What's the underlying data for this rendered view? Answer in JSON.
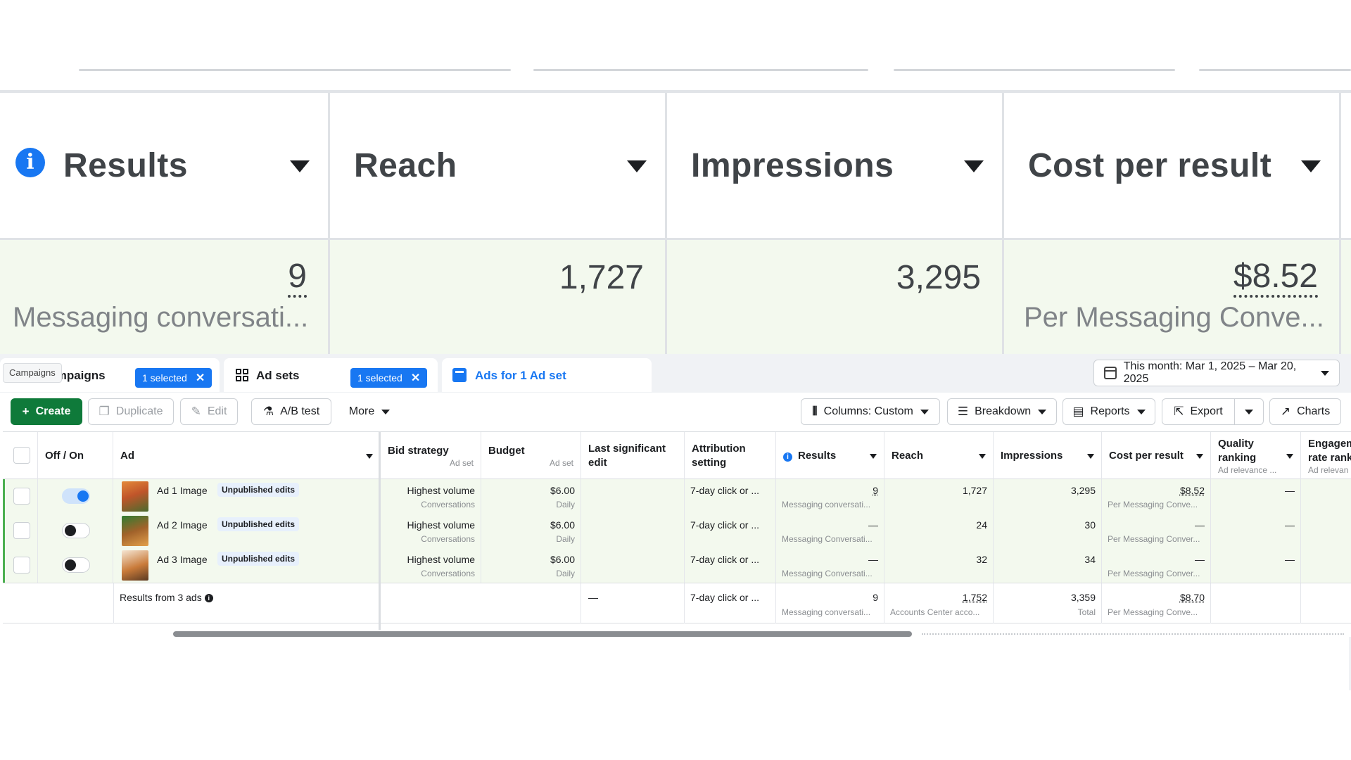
{
  "zoom": {
    "columns": [
      {
        "title": "Results",
        "value": "9",
        "sub": "Messaging conversati..."
      },
      {
        "title": "Reach",
        "value": "1,727",
        "sub": ""
      },
      {
        "title": "Impressions",
        "value": "3,295",
        "sub": ""
      },
      {
        "title": "Cost per result",
        "value": "$8.52",
        "sub": "Per Messaging Conve..."
      }
    ]
  },
  "tabs": {
    "tooltip": "Campaigns",
    "campaigns": {
      "label": "Campaigns",
      "badge": "1 selected"
    },
    "adsets": {
      "label": "Ad sets",
      "badge": "1 selected"
    },
    "ads": {
      "label": "Ads for 1 Ad set"
    },
    "date_range": "This month: Mar 1, 2025 – Mar 20, 2025"
  },
  "toolbar": {
    "create": "Create",
    "duplicate": "Duplicate",
    "edit": "Edit",
    "abtest": "A/B test",
    "more": "More",
    "columns": "Columns: Custom",
    "breakdown": "Breakdown",
    "reports": "Reports",
    "export": "Export",
    "charts": "Charts"
  },
  "table": {
    "headers": {
      "offon": "Off / On",
      "ad": "Ad",
      "bid": "Bid strategy",
      "bid_sub": "Ad set",
      "budget": "Budget",
      "budget_sub": "Ad set",
      "last_edit": "Last significant edit",
      "attribution": "Attribution setting",
      "results": "Results",
      "reach": "Reach",
      "impressions": "Impressions",
      "cpr": "Cost per result",
      "quality": "Quality ranking",
      "quality_sub": "Ad relevance ...",
      "engagement": "Engagement rate rank",
      "engagement_sub": "Ad relevan"
    },
    "rows": [
      {
        "toggle_on": true,
        "name": "Ad 1 Image",
        "badge": "Unpublished edits",
        "bid": "Highest volume",
        "bid_sub": "Conversations",
        "budget": "$6.00",
        "budget_sub": "Daily",
        "attribution": "7-day click or ...",
        "results": "9",
        "results_sub": "Messaging conversati...",
        "reach": "1,727",
        "impressions": "3,295",
        "cpr": "$8.52",
        "cpr_sub": "Per Messaging Conve...",
        "quality": "—"
      },
      {
        "toggle_on": false,
        "name": "Ad 2 Image",
        "badge": "Unpublished edits",
        "bid": "Highest volume",
        "bid_sub": "Conversations",
        "budget": "$6.00",
        "budget_sub": "Daily",
        "attribution": "7-day click or ...",
        "results": "—",
        "results_sub": "Messaging Conversati...",
        "reach": "24",
        "impressions": "30",
        "cpr": "—",
        "cpr_sub": "Per Messaging Conver...",
        "quality": "—"
      },
      {
        "toggle_on": false,
        "name": "Ad 3 Image",
        "badge": "Unpublished edits",
        "bid": "Highest volume",
        "bid_sub": "Conversations",
        "budget": "$6.00",
        "budget_sub": "Daily",
        "attribution": "7-day click or ...",
        "results": "—",
        "results_sub": "Messaging Conversati...",
        "reach": "32",
        "impressions": "34",
        "cpr": "—",
        "cpr_sub": "Per Messaging Conver...",
        "quality": "—"
      }
    ],
    "footer": {
      "label": "Results from 3 ads",
      "last_edit": "—",
      "attribution": "7-day click or ...",
      "results": "9",
      "results_sub": "Messaging conversati...",
      "reach": "1,752",
      "reach_sub": "Accounts Center acco...",
      "impressions": "3,359",
      "impressions_sub": "Total",
      "cpr": "$8.70",
      "cpr_sub": "Per Messaging Conve..."
    }
  },
  "colors": {
    "accent": "#1877f2",
    "create": "#0f7a3a",
    "row_highlight": "#f3f9ee"
  }
}
